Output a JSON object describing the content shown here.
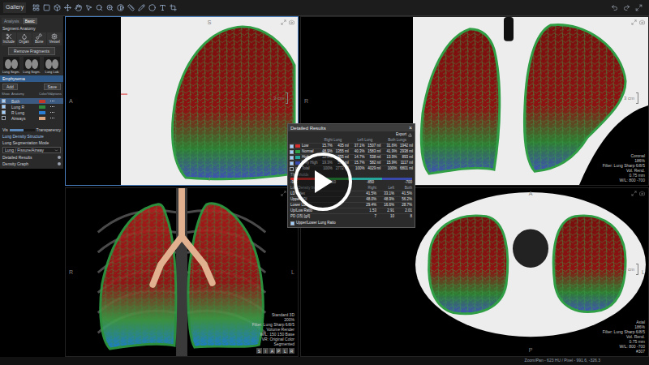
{
  "toolbar": {
    "title": "Gallery"
  },
  "left_panel": {
    "tabs": [
      {
        "label": "Analysis",
        "selected": false
      },
      {
        "label": "Basic",
        "selected": true
      }
    ],
    "section": "Segment Anatomy",
    "tools": [
      "Include",
      "Organ",
      "Bone",
      "Vessel"
    ],
    "remove_button": "Remove Fragments",
    "presets": [
      "Lung Segm.",
      "Lung Segm.",
      "Lung Lob."
    ],
    "group_title": "Emphysema",
    "buttons": [
      "Add",
      "Save"
    ],
    "columns": [
      "Show",
      "Anatomy",
      "Color/Vis",
      "Options"
    ],
    "items": [
      {
        "name": "Both",
        "checked": true,
        "selected": true,
        "color": "#c0392b"
      },
      {
        "name": "Lung R",
        "checked": true,
        "selected": false,
        "color": "#2e8b3a"
      },
      {
        "name": "R Lung",
        "checked": true,
        "selected": false,
        "color": "#2a7fd4"
      },
      {
        "name": "Airways",
        "checked": false,
        "selected": false,
        "color": "#d9a47c"
      }
    ],
    "transparency": {
      "prefix": "Vis",
      "label": "Transparency",
      "level": 0.55
    },
    "density_link": "Lung Density Structure",
    "mode_label": "Lung Segmentation Mode",
    "mode_value": "Lung / Fissure/Airway",
    "links": [
      "Detailed Results",
      "Density Graph"
    ]
  },
  "viewports": [
    {
      "kind": "sagittal",
      "selected": true,
      "top": "S",
      "bottom": "I",
      "left": "A",
      "right": "",
      "scale": "3 cm",
      "info": []
    },
    {
      "kind": "coronal",
      "selected": false,
      "top": "",
      "bottom": "",
      "left": "R",
      "right": "",
      "scale": "3 cm",
      "info": [
        "Coronal",
        "186%",
        "Filter: Lung Sharp 6/8/5",
        "Vol. Rend.",
        "0.75 mm",
        "W/L: 800 -700"
      ]
    },
    {
      "kind": "3d",
      "selected": false,
      "top": "",
      "bottom": "",
      "left": "R",
      "right": "L",
      "scale": "",
      "info": [
        "Standard 3D",
        "200%",
        "Filter: Lung Sharp 6/8/5",
        "Volume Render",
        "W/L: 150 150 Base",
        "VR: Original Color",
        "Segmented"
      ],
      "cube": [
        "S",
        "I",
        "A",
        "P",
        "L",
        "R"
      ]
    },
    {
      "kind": "axial",
      "selected": false,
      "top": "A",
      "bottom": "P",
      "left": "",
      "right": "L",
      "scale": "3 cm",
      "info": [
        "Axial",
        "186%",
        "Filter: Lung Sharp 6/8/5",
        "Vol. Rend.",
        "0.75 mm",
        "W/L: 800 -700",
        "#307"
      ]
    }
  ],
  "dialog": {
    "title": "Detailed Results",
    "close": "×",
    "export": "Export",
    "columns": [
      "Right Lung",
      "Left Lung",
      "Both Lungs"
    ],
    "rows": [
      {
        "label": "Low",
        "checked": true,
        "color": "#d32f2f",
        "values": [
          "15.7%",
          "435 ml",
          "37.1%",
          "1507 ml",
          "31.6%",
          "1942 ml"
        ]
      },
      {
        "label": "Normal",
        "checked": true,
        "color": "#2e9e44",
        "values": [
          "48.9%",
          "1355 ml",
          "40.3%",
          "1583 ml",
          "41.9%",
          "2938 ml"
        ]
      },
      {
        "label": "High",
        "checked": true,
        "color": "#26a69a",
        "values": [
          "12.8%",
          "355 ml",
          "14.7%",
          "538 ml",
          "13.9%",
          "893 ml"
        ]
      },
      {
        "label": "Very High",
        "checked": true,
        "color": "#3949ab",
        "values": [
          "19.3%",
          "535 ml",
          "15.7%",
          "582 ml",
          "15.9%",
          "1117 ml"
        ]
      },
      {
        "label": "Total",
        "checked": false,
        "color": "#6b6b6b",
        "values": [
          "100%",
          "2772 ml",
          "100%",
          "4029 ml",
          "100%",
          "6801 ml"
        ]
      }
    ],
    "threshold": {
      "label": "Thresholds",
      "values": [
        "-950",
        "-910",
        "-850",
        "-700"
      ]
    },
    "index_title": "Low Density Index",
    "index_columns": [
      "Right",
      "Left",
      "Both"
    ],
    "index_rows": [
      {
        "label": "LD Index",
        "values": [
          "41.5%",
          "33.1%",
          "41.5%"
        ]
      },
      {
        "label": "Upper LDI",
        "values": [
          "48.0%",
          "48.9%",
          "56.2%"
        ]
      },
      {
        "label": "Lower LDI",
        "values": [
          "29.4%",
          "16.6%",
          "28.7%"
        ]
      },
      {
        "label": "Up/Low Ratio",
        "values": [
          "1.53",
          "2.91",
          "2.01"
        ]
      },
      {
        "label": "PD (15) [g/l]",
        "values": [
          "7",
          "10",
          "8"
        ]
      }
    ],
    "footer": {
      "label": "Upper/Lower Lung Ratio",
      "checked": true
    }
  },
  "status_bar": {
    "text": "Zoom/Pan - 623 HU / Pixel - 991.6, -326.3"
  }
}
